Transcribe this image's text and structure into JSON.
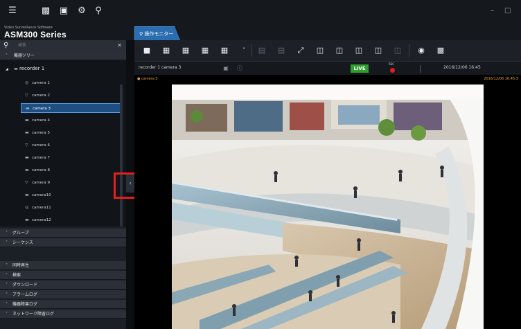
{
  "app": {
    "brand_subtitle": "Video Surveillance Software",
    "brand_title": "ASM300 Series"
  },
  "tabs": [
    {
      "label": "操作モニター"
    }
  ],
  "sidebar": {
    "search_placeholder": "検索",
    "tree_header": "機器ツリー",
    "recorder": "recorder 1",
    "cameras": [
      {
        "label": "camera 1",
        "icon": "dome-camera-icon"
      },
      {
        "label": "camera 2",
        "icon": "ptz-camera-icon"
      },
      {
        "label": "camera 3",
        "icon": "box-camera-icon",
        "selected": true
      },
      {
        "label": "camera 4",
        "icon": "box-camera-icon"
      },
      {
        "label": "camera 5",
        "icon": "box-camera-icon"
      },
      {
        "label": "camera 6",
        "icon": "ptz-camera-icon"
      },
      {
        "label": "camera 7",
        "icon": "box-camera-icon"
      },
      {
        "label": "camera 8",
        "icon": "box-camera-icon"
      },
      {
        "label": "camera 9",
        "icon": "ptz-camera-icon"
      },
      {
        "label": "camera10",
        "icon": "box-camera-icon"
      },
      {
        "label": "camera11",
        "icon": "dome-camera-icon"
      },
      {
        "label": "camera12",
        "icon": "box-camera-icon"
      }
    ],
    "sections_a": [
      "グループ",
      "シーケンス"
    ],
    "sections_b": [
      "同時再生",
      "検索",
      "ダウンロード",
      "アラームログ",
      "機器障害ログ",
      "ネットワーク障害ログ"
    ]
  },
  "statusbar": {
    "camera_name": "recorder 1 camera 3",
    "live": "LIVE",
    "rec": "REC",
    "datetime": "2016/12/06 16:45"
  },
  "viewer": {
    "camera_label": "camera 3",
    "timestamp": "2016/12/06 16:45:3"
  },
  "colors": {
    "accent": "#2a6db0",
    "live": "#2da02b",
    "rec": "#e3201b",
    "highlight": "#e3201b",
    "overlay_text": "#e8a030"
  }
}
